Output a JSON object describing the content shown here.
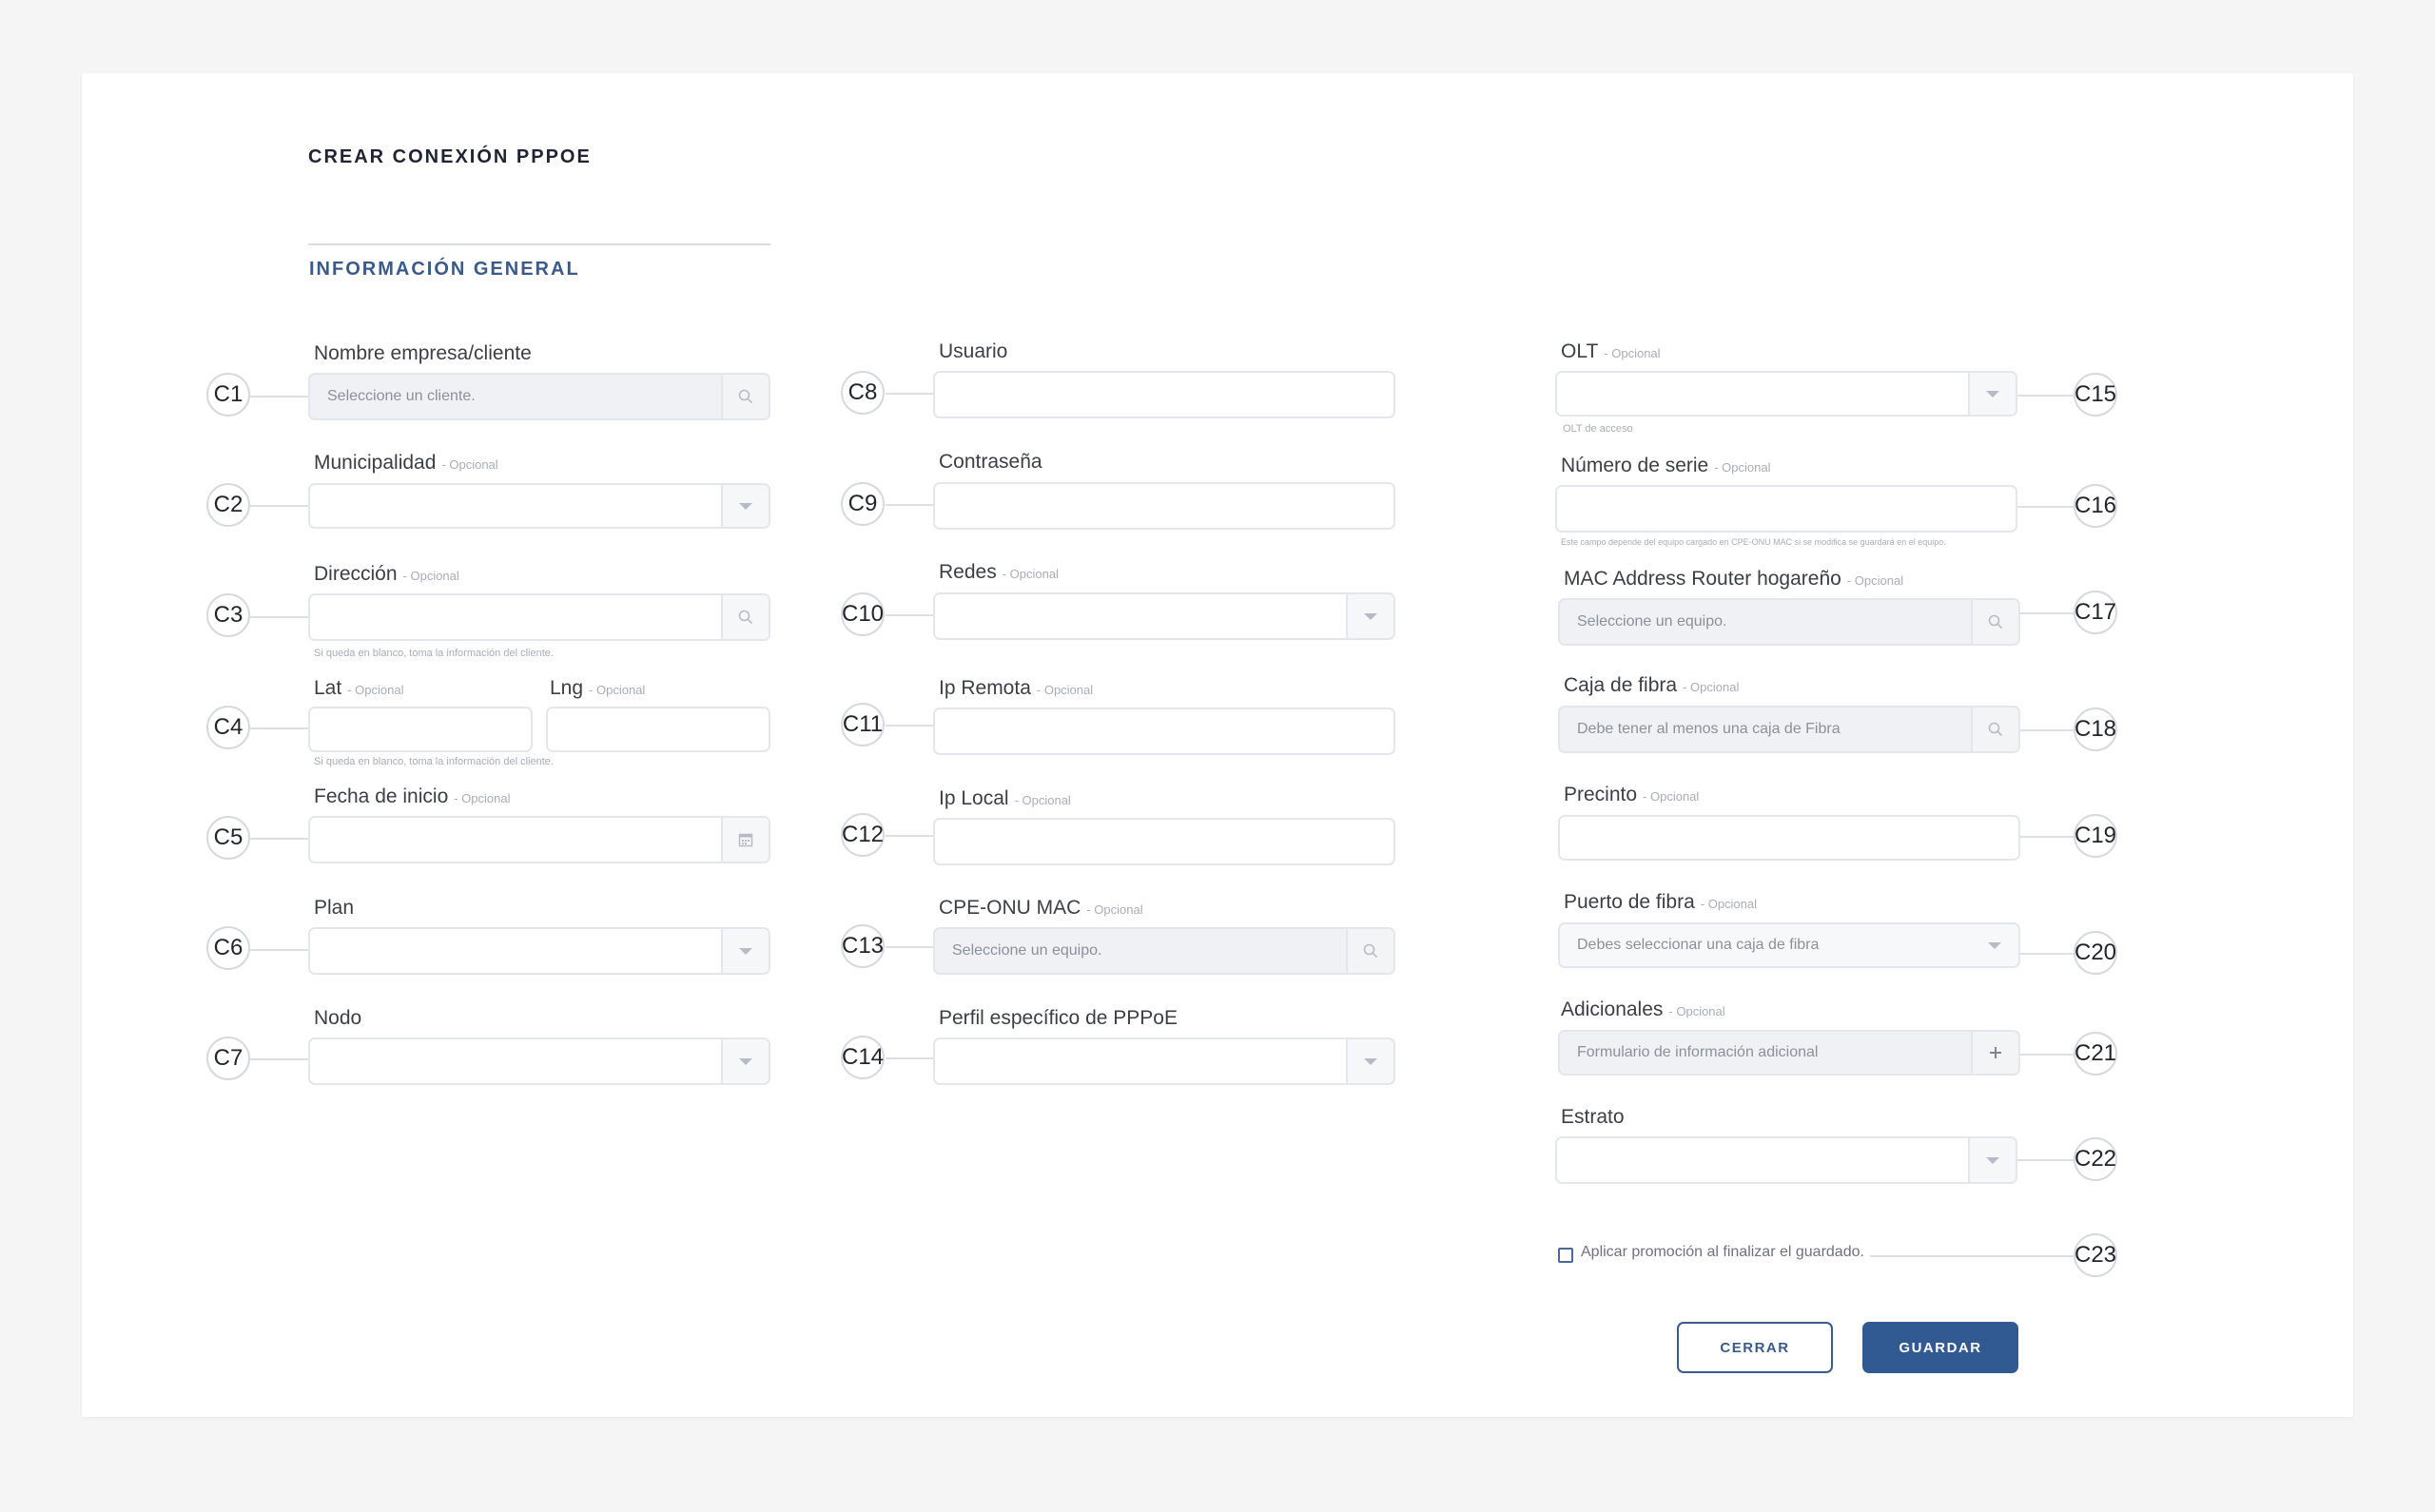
{
  "title": "CREAR CONEXIÓN PPPOE",
  "section_title": "INFORMACIÓN GENERAL",
  "optional_tag": "- Opcional",
  "fields": {
    "c1": {
      "marker": "C1",
      "label": "Nombre empresa/cliente",
      "placeholder": "Seleccione un cliente."
    },
    "c2": {
      "marker": "C2",
      "label": "Municipalidad"
    },
    "c3": {
      "marker": "C3",
      "label": "Dirección",
      "help": "Si queda en blanco, toma la información del cliente."
    },
    "c4": {
      "marker": "C4",
      "label_lat": "Lat",
      "label_lng": "Lng",
      "help": "Si queda en blanco, toma la información del cliente."
    },
    "c5": {
      "marker": "C5",
      "label": "Fecha de inicio"
    },
    "c6": {
      "marker": "C6",
      "label": "Plan"
    },
    "c7": {
      "marker": "C7",
      "label": "Nodo"
    },
    "c8": {
      "marker": "C8",
      "label": "Usuario"
    },
    "c9": {
      "marker": "C9",
      "label": "Contraseña"
    },
    "c10": {
      "marker": "C10",
      "label": "Redes"
    },
    "c11": {
      "marker": "C11",
      "label": "Ip Remota"
    },
    "c12": {
      "marker": "C12",
      "label": "Ip Local"
    },
    "c13": {
      "marker": "C13",
      "label": "CPE-ONU MAC",
      "placeholder": "Seleccione un equipo."
    },
    "c14": {
      "marker": "C14",
      "label": "Perfil específico de PPPoE"
    },
    "c15": {
      "marker": "C15",
      "label": "OLT",
      "help": "OLT de acceso"
    },
    "c16": {
      "marker": "C16",
      "label": "Número de serie",
      "help": "Este campo depende del equipo cargado en CPE-ONU MAC si se modifica se guardará en el equipo."
    },
    "c17": {
      "marker": "C17",
      "label": "MAC Address Router hogareño",
      "placeholder": "Seleccione un equipo."
    },
    "c18": {
      "marker": "C18",
      "label": "Caja de fibra",
      "placeholder": "Debe tener al menos una caja de Fibra"
    },
    "c19": {
      "marker": "C19",
      "label": "Precinto"
    },
    "c20": {
      "marker": "C20",
      "label": "Puerto de fibra",
      "placeholder": "Debes seleccionar una caja de fibra"
    },
    "c21": {
      "marker": "C21",
      "label": "Adicionales",
      "placeholder": "Formulario de información adicional"
    },
    "c22": {
      "marker": "C22",
      "label": "Estrato"
    },
    "c23": {
      "marker": "C23",
      "checkbox_label": "Aplicar promoción al finalizar el guardado.",
      "checked": false
    }
  },
  "buttons": {
    "close": "CERRAR",
    "save": "GUARDAR"
  },
  "icons": {
    "search": "search-icon",
    "dropdown": "chevron-down-icon",
    "calendar": "calendar-icon",
    "plus": "plus-icon"
  },
  "colors": {
    "accent": "#325a92",
    "section_title": "#3a5a8c",
    "field_border": "#e3e6eb",
    "disabled_bg": "#eff1f4"
  }
}
